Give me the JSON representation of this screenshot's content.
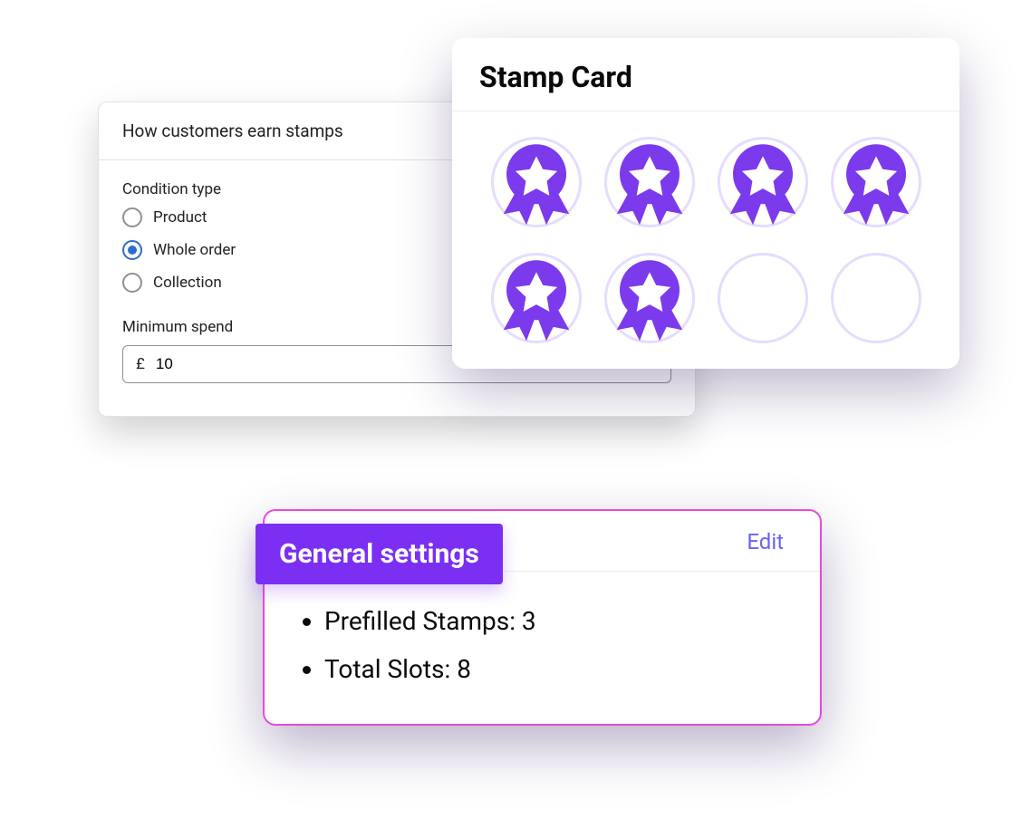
{
  "earn": {
    "header": "How customers earn stamps",
    "condition_label": "Condition type",
    "options": {
      "product": "Product",
      "whole_order": "Whole order",
      "collection": "Collection"
    },
    "selected": "whole_order",
    "min_spend_label": "Minimum spend",
    "currency_symbol": "£",
    "min_spend_value": "10"
  },
  "stamp_card": {
    "title": "Stamp Card",
    "total_slots": 8,
    "filled_slots": 6
  },
  "settings": {
    "title": "General settings",
    "edit_label": "Edit",
    "items": [
      "Prefilled Stamps: 3",
      "Total Slots: 8"
    ]
  },
  "colors": {
    "accent_purple": "#7b2ff2",
    "badge_purple": "#7c3aed",
    "link_blue": "#6a63f6",
    "selected_radio": "#2c6ecb",
    "pink_border": "#e84adf"
  }
}
